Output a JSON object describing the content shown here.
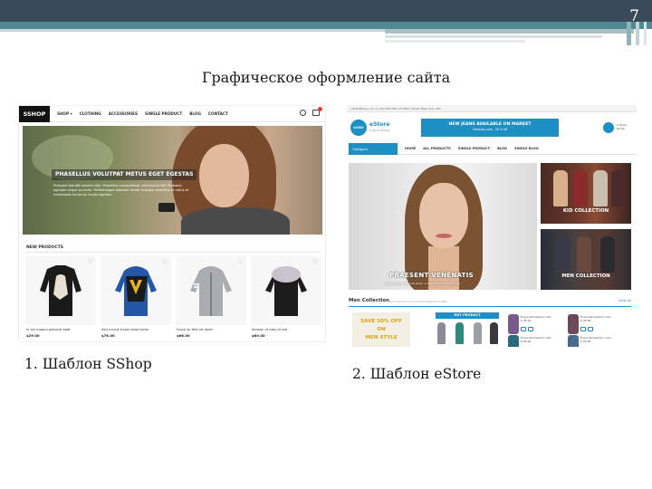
{
  "slide": {
    "number": "7",
    "title": "Графическое оформление сайта",
    "caption1": "1. Шаблон SShop",
    "caption2": "2. Шаблон eStore"
  },
  "sshop": {
    "logo": "SSHOP",
    "nav": [
      "SHOP ▾",
      "CLOTHING",
      "ACCESSORIES",
      "SINGLE PRODUCT",
      "BLOG",
      "CONTACT"
    ],
    "hero_title": "PHASELLUS VOLUTPAT METUS EGET EGESTAS",
    "hero_text": "Praesent blandit laoreet nibh. Phasellus consectetuer vestibulum elit. Praesent egestas neque eu enim. Pellentesque habitant morbi tristique senectus et netus et malesuada fames ac turpis egestas.",
    "section_title": "NEW PRODUCTS",
    "products": [
      {
        "name": "In dui magna posuere eget",
        "price": "$29.00"
      },
      {
        "name": "Sed cursus turpis vitae tortor",
        "price": "$76.00"
      },
      {
        "name": "Fusce ac felis sit amet",
        "price": "$66.00"
      },
      {
        "name": "Aenean ut eros et nisl",
        "price": "$89.00"
      }
    ],
    "icons": [
      "search-icon",
      "cart-icon"
    ]
  },
  "estore": {
    "topbar": "info@eStore.com   +1 234 567 890   123 Main Street, New York, USA",
    "logo": "LOGO",
    "logo_name": "eStore",
    "logo_sub": "Original theme",
    "banner_title": "NEW JEANS AVAILABLE ON MARKET",
    "banner_sub": "Saturday sale - 50 % off",
    "cart_text": "0 Items",
    "cart_sub": "$0.00",
    "category": "Category",
    "nav": [
      "HOME",
      "ALL PRODUCTS",
      "SINGLE PRODUCT",
      "BLOG",
      "SINGLE BLOG"
    ],
    "slider_title": "PRAESENT VENENATIS",
    "slider_sub": "Lorem ipsum dolor sit amet, consectetur adipiscing elit",
    "promo1": "KID COLLECTION",
    "promo2": "MEN COLLECTION",
    "collection_title": "Men Collection",
    "collection_sub": "Find it above our products featured on Site",
    "view_all": "View all",
    "sale": [
      "SAVE 50% OFF",
      "ON",
      "MEN STYLE"
    ],
    "hot": "HOT PRODUCT",
    "items": [
      {
        "name": "Fusce fermentum odio",
        "price": "$ 25.00"
      },
      {
        "name": "Fusce fermentum odio",
        "price": "$ 25.00"
      },
      {
        "name": "Fusce fermentum odio",
        "price": "$ 25.00"
      },
      {
        "name": "Fusce fermentum odio",
        "price": "$ 25.00"
      }
    ]
  },
  "colors": {
    "header_dark": "#3b4a5a",
    "header_teal": "#4f8a93",
    "estore_blue": "#1d8fc3"
  }
}
